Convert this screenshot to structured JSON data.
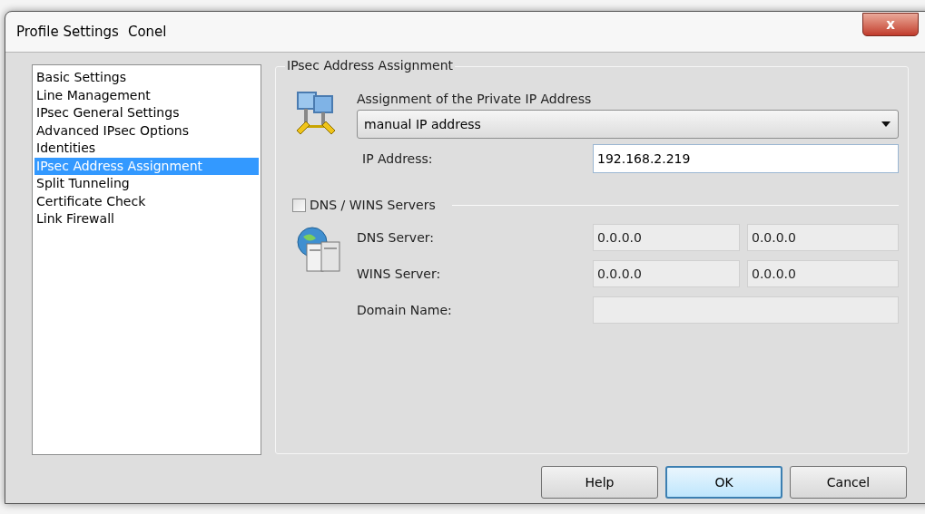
{
  "window": {
    "title": "Profile Settings",
    "profile_name": "Conel",
    "close": "x"
  },
  "sidebar": {
    "items": [
      {
        "label": "Basic Settings",
        "selected": false
      },
      {
        "label": "Line Management",
        "selected": false
      },
      {
        "label": "IPsec General Settings",
        "selected": false
      },
      {
        "label": "Advanced IPsec Options",
        "selected": false
      },
      {
        "label": "Identities",
        "selected": false
      },
      {
        "label": "IPsec Address Assignment",
        "selected": true
      },
      {
        "label": "Split Tunneling",
        "selected": false
      },
      {
        "label": "Certificate Check",
        "selected": false
      },
      {
        "label": "Link Firewall",
        "selected": false
      }
    ]
  },
  "group": {
    "title": "IPsec Address Assignment",
    "assignment": {
      "label": "Assignment of the Private IP Address",
      "value": "manual IP address"
    },
    "ip_address": {
      "label": "IP Address:",
      "value": "192.168.2.219"
    },
    "servers": {
      "label": "DNS / WINS Servers",
      "checked": false,
      "rows": [
        {
          "kind": "pair",
          "label": "DNS Server:",
          "values": [
            "0.0.0.0",
            "0.0.0.0"
          ]
        },
        {
          "kind": "pair",
          "label": "WINS Server:",
          "values": [
            "0.0.0.0",
            "0.0.0.0"
          ]
        },
        {
          "kind": "single",
          "label": "Domain Name:"
        }
      ]
    }
  },
  "buttons": [
    {
      "label": "Help",
      "default": false
    },
    {
      "label": "OK",
      "default": true
    },
    {
      "label": "Cancel",
      "default": false
    }
  ]
}
